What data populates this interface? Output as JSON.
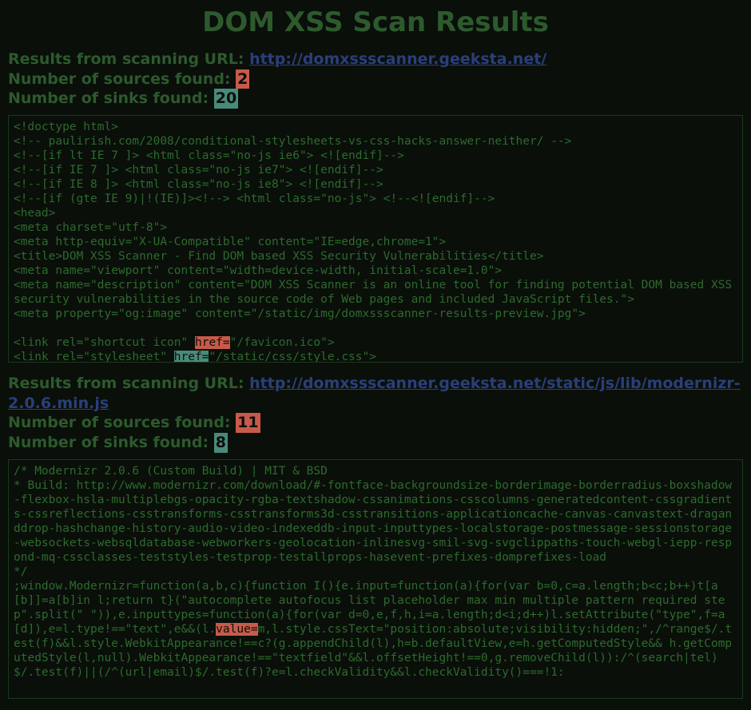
{
  "title": "DOM XSS Scan Results",
  "sections": [
    {
      "url_label": "Results from scanning URL: ",
      "url": "http://domxssscanner.geeksta.net/",
      "sources_label": "Number of sources found: ",
      "sources_count": "2",
      "sinks_label": "Number of sinks found: ",
      "sinks_count": "20",
      "code_lines": [
        "<!doctype html>",
        "<!-- paulirish.com/2008/conditional-stylesheets-vs-css-hacks-answer-neither/ -->",
        "<!--[if lt IE 7 ]> <html class=\"no-js ie6\"> <![endif]-->",
        "<!--[if IE 7 ]> <html class=\"no-js ie7\"> <![endif]-->",
        "<!--[if IE 8 ]> <html class=\"no-js ie8\"> <![endif]-->",
        "<!--[if (gte IE 9)|!(IE)]><!--> <html class=\"no-js\"> <!--<![endif]-->",
        "<head>",
        "<meta charset=\"utf-8\">",
        "<meta http-equiv=\"X-UA-Compatible\" content=\"IE=edge,chrome=1\">",
        "<title>DOM XSS Scanner - Find DOM based XSS Security Vulnerabilities</title>",
        "<meta name=\"viewport\" content=\"width=device-width, initial-scale=1.0\">",
        "<meta name=\"description\" content=\"DOM XSS Scanner is an online tool for finding potential DOM based XSS security vulnerabilities in the source code of Web pages and included JavaScript files.\">",
        "<meta property=\"og:image\" content=\"/static/img/domxssscanner-results-preview.jpg\">",
        "",
        {
          "pre": "<link rel=\"shortcut icon\" ",
          "hl": "href=",
          "hlClass": "hl-red",
          "post": "\"/favicon.ico\">"
        },
        {
          "pre": "<link rel=\"stylesheet\" ",
          "hl": "href=",
          "hlClass": "hl-teal",
          "post": "\"/static/css/style.css\">"
        }
      ]
    },
    {
      "url_label": "Results from scanning URL: ",
      "url": "http://domxssscanner.geeksta.net/static/js/lib/modernizr-2.0.6.min.js",
      "sources_label": "Number of sources found: ",
      "sources_count": "11",
      "sinks_label": "Number of sinks found: ",
      "sinks_count": "8",
      "code_lines": [
        "/* Modernizr 2.0.6 (Custom Build) | MIT & BSD",
        "* Build: http://www.modernizr.com/download/#-fontface-backgroundsize-borderimage-borderradius-boxshadow-flexbox-hsla-multiplebgs-opacity-rgba-textshadow-cssanimations-csscolumns-generatedcontent-cssgradients-cssreflections-csstransforms-csstransforms3d-csstransitions-applicationcache-canvas-canvastext-draganddrop-hashchange-history-audio-video-indexeddb-input-inputtypes-localstorage-postmessage-sessionstorage-websockets-websqldatabase-webworkers-geolocation-inlinesvg-smil-svg-svgclippaths-touch-webgl-iepp-respond-mq-cssclasses-teststyles-testprop-testallprops-hasevent-prefixes-domprefixes-load",
        "*/",
        {
          "pre": ";window.Modernizr=function(a,b,c){function I(){e.input=function(a){for(var b=0,c=a.length;b<c;b++)t[a[b]]=a[b]in l;return t}(\"autocomplete autofocus list placeholder max min multiple pattern required step\".split(\" \")),e.inputtypes=function(a){for(var d=0,e,f,h,i=a.length;d<i;d++)l.setAttribute(\"type\",f=a[d]),e=l.type!==\"text\",e&&(l.",
          "hl": "value=",
          "hlClass": "hl-red",
          "post": "m,l.style.cssText=\"position:absolute;visibility:hidden;\",/^range$/.test(f)&&l.style.WebkitAppearance!==c?(g.appendChild(l),h=b.defaultView,e=h.getComputedStyle&& h.getComputedStyle(l,null).WebkitAppearance!==\"textfield\"&&l.offsetHeight!==0,g.removeChild(l)):/^(search|tel)$/.test(f)||(/^(url|email)$/.test(f)?e=l.checkValidity&&l.checkValidity()===!1:"
        }
      ]
    }
  ]
}
